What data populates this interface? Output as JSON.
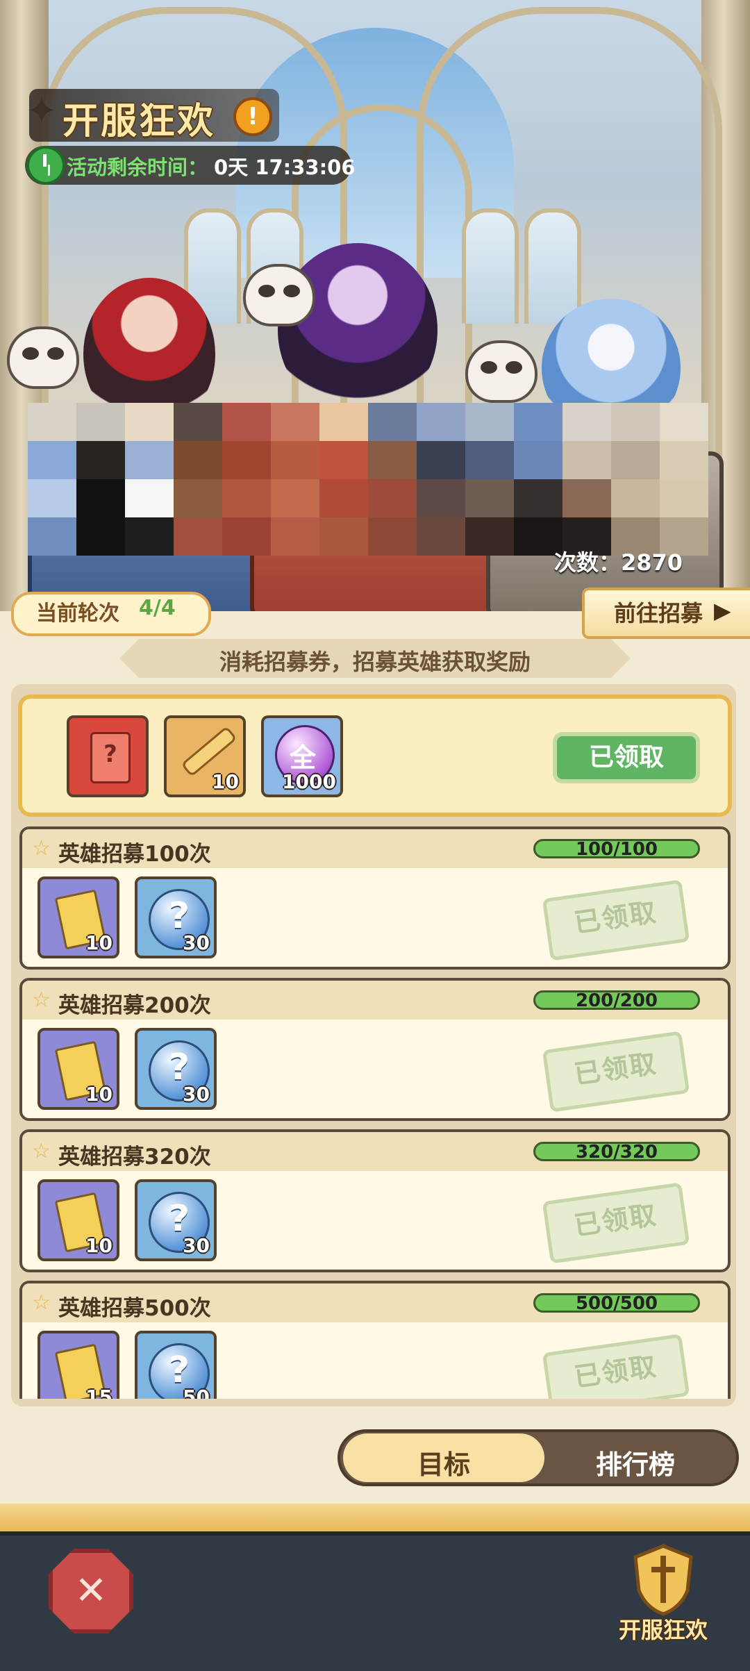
{
  "event": {
    "title": "开服狂欢",
    "timer_label": "活动剩余时间：",
    "timer_value": "0天 17:33:06",
    "recruit_count": "次数：2870"
  },
  "round": {
    "label": "当前轮次",
    "value": "4/4",
    "goto_label": "前往招募"
  },
  "subtitle": "消耗招募券，招募英雄获取奖励",
  "grand_reward": {
    "items": [
      {
        "icon": "mystery-card-icon",
        "qty": ""
      },
      {
        "icon": "key-icon",
        "qty": "10"
      },
      {
        "icon": "all-orb-icon",
        "qty": "1000",
        "glyph": "全"
      }
    ],
    "status": "已领取"
  },
  "tasks": [
    {
      "title": "英雄招募100次",
      "progress": "100/100",
      "progress_fraction": 1.0,
      "rewards": [
        {
          "icon": "recruit-ticket-icon",
          "qty": "10"
        },
        {
          "icon": "mystery-orb-icon",
          "qty": "30"
        }
      ],
      "status": "已领取"
    },
    {
      "title": "英雄招募200次",
      "progress": "200/200",
      "progress_fraction": 1.0,
      "rewards": [
        {
          "icon": "recruit-ticket-icon",
          "qty": "10"
        },
        {
          "icon": "mystery-orb-icon",
          "qty": "30"
        }
      ],
      "status": "已领取"
    },
    {
      "title": "英雄招募320次",
      "progress": "320/320",
      "progress_fraction": 1.0,
      "rewards": [
        {
          "icon": "recruit-ticket-icon",
          "qty": "10"
        },
        {
          "icon": "mystery-orb-icon",
          "qty": "30"
        }
      ],
      "status": "已领取"
    },
    {
      "title": "英雄招募500次",
      "progress": "500/500",
      "progress_fraction": 1.0,
      "rewards": [
        {
          "icon": "recruit-ticket-icon",
          "qty": "15"
        },
        {
          "icon": "mystery-orb-icon",
          "qty": "50"
        }
      ],
      "status": "已领取"
    }
  ],
  "tabs": {
    "target": "目标",
    "ranking": "排行榜"
  },
  "bottom": {
    "event_label": "开服狂欢"
  },
  "colors": {
    "accent_gold": "#e9b94d",
    "progress_green": "#73c95a",
    "claimed_green": "#5fb563",
    "timer_green": "#7be36f"
  }
}
